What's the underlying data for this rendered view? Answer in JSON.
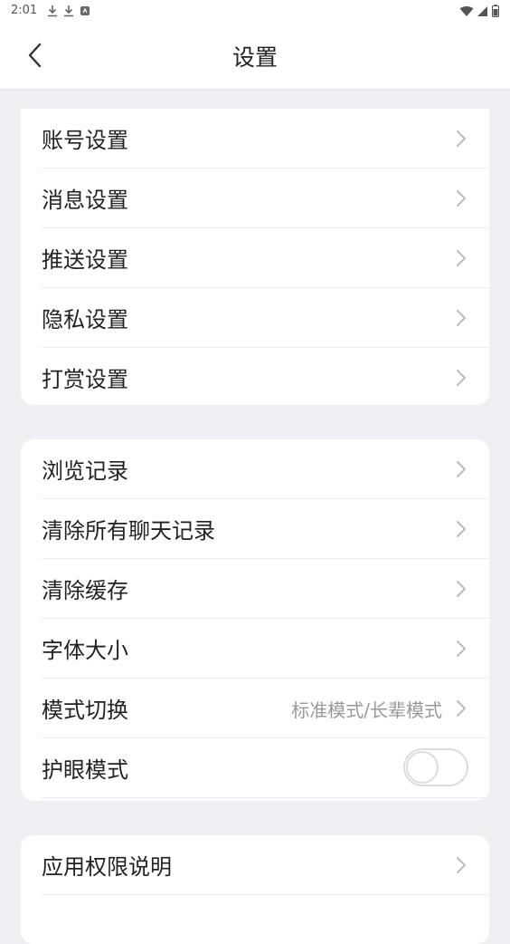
{
  "status_bar": {
    "time": "2:01"
  },
  "header": {
    "title": "设置"
  },
  "groups": [
    {
      "items": [
        {
          "label": "账号设置"
        },
        {
          "label": "消息设置"
        },
        {
          "label": "推送设置"
        },
        {
          "label": "隐私设置"
        },
        {
          "label": "打赏设置"
        }
      ]
    },
    {
      "items": [
        {
          "label": "浏览记录"
        },
        {
          "label": "清除所有聊天记录"
        },
        {
          "label": "清除缓存"
        },
        {
          "label": "字体大小"
        },
        {
          "label": "模式切换",
          "value": "标准模式/长辈模式"
        },
        {
          "label": "护眼模式",
          "toggle_on": false
        }
      ]
    },
    {
      "items": [
        {
          "label": "应用权限说明"
        }
      ]
    }
  ],
  "icons": {
    "back": "chevron-left-icon",
    "row": "chevron-right-icon"
  }
}
